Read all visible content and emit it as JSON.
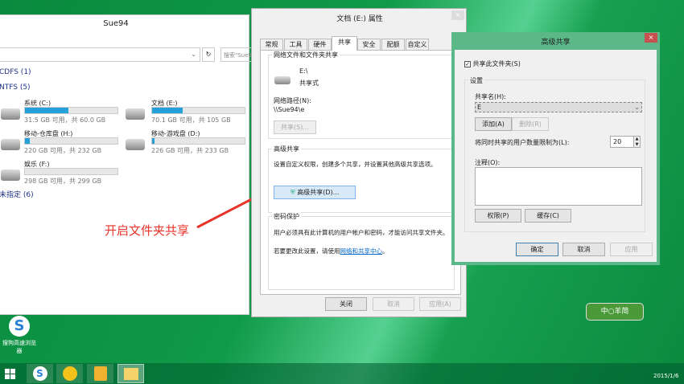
{
  "explorer": {
    "title": "Sue94",
    "search_placeholder": "搜索\"Sue94\"",
    "groups": [
      {
        "label": "CDFS (1)"
      },
      {
        "label": "NTFS (5)"
      },
      {
        "label": "未指定 (6)"
      }
    ],
    "drives": [
      {
        "name": "系统 (C:)",
        "info": "31.5 GB 可用，共 60.0 GB",
        "used_pct": 47
      },
      {
        "name": "文档 (E:)",
        "info": "70.1 GB 可用，共 105 GB",
        "used_pct": 33
      },
      {
        "name": "移动-仓库盘 (H:)",
        "info": "220 GB 可用，共 232 GB",
        "used_pct": 5
      },
      {
        "name": "移动-游戏盘 (D:)",
        "info": "226 GB 可用，共 233 GB",
        "used_pct": 3
      },
      {
        "name": "娱乐 (F:)",
        "info": "298 GB 可用，共 299 GB",
        "used_pct": 0
      }
    ]
  },
  "props": {
    "title": "文档 (E:) 属性",
    "tabs": [
      "常规",
      "工具",
      "硬件",
      "共享",
      "安全",
      "配额",
      "自定义"
    ],
    "net_group": "网络文件和文件夹共享",
    "path_name": "E:\\",
    "share_state": "共享式",
    "net_path_label": "网络路径(N):",
    "net_path": "\\\\Sue94\\e",
    "share_btn": "共享(S)...",
    "adv_group": "高级共享",
    "adv_desc": "设置自定义权限，创建多个共享，并设置其他高级共享选项。",
    "adv_btn": "高级共享(D)...",
    "pwd_group": "密码保护",
    "pwd_desc": "用户必须具有此计算机的用户帐户和密码，才能访问共享文件夹。",
    "pwd_change": "若要更改此设置，请使用",
    "pwd_link": "网络和共享中心",
    "pwd_end": "。",
    "close": "关闭",
    "cancel": "取消",
    "apply": "应用(A)"
  },
  "adv": {
    "title": "高级共享",
    "share_check": "共享此文件夹(S)",
    "checked": true,
    "settings": "设置",
    "share_name_label": "共享名(H):",
    "share_name": "E",
    "add": "添加(A)",
    "remove": "删除(R)",
    "limit_label": "将同时共享的用户数量限制为(L):",
    "limit": "20",
    "comment_label": "注释(O):",
    "perm": "权限(P)",
    "cache": "缓存(C)",
    "ok": "确定",
    "cancel": "取消",
    "apply": "应用"
  },
  "annotation": "开启文件夹共享",
  "desktop_icon": "搜狗高速浏览器",
  "watermark": "中○羊简",
  "clock": {
    "date": "2015/1/6"
  },
  "colors": {
    "accent": "#26a0da",
    "dialog_title": "#5cb888",
    "annotation": "#e8332a"
  }
}
